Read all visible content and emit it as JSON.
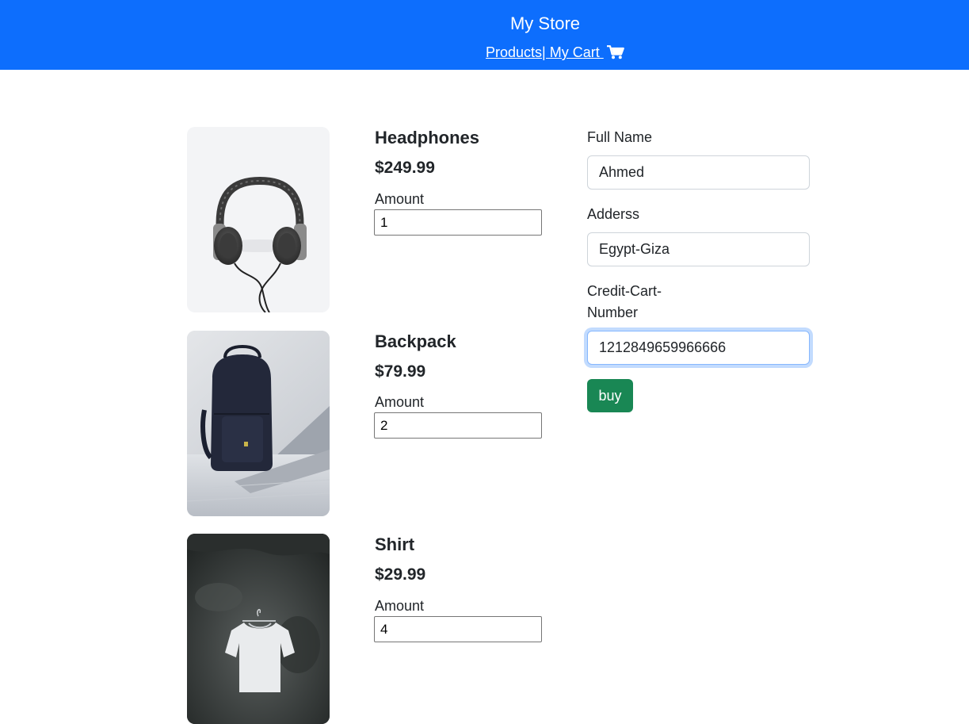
{
  "header": {
    "title": "My Store",
    "nav_products": "Products",
    "nav_cart": "| My Cart "
  },
  "products": [
    {
      "name": "Headphones",
      "price": "$249.99",
      "amount_label": "Amount",
      "amount": "1"
    },
    {
      "name": "Backpack",
      "price": "$79.99",
      "amount_label": "Amount",
      "amount": "2"
    },
    {
      "name": "Shirt",
      "price": "$29.99",
      "amount_label": "Amount",
      "amount": "4"
    }
  ],
  "form": {
    "full_name_label": "Full Name",
    "full_name_value": "Ahmed",
    "address_label": "Adderss",
    "address_value": "Egypt-Giza",
    "card_label_line1": "Credit-Cart-",
    "card_label_line2": "Number",
    "card_value": "1212849659966666",
    "buy_label": "buy"
  },
  "colors": {
    "header_bg": "#0d6efd",
    "buy_button": "#198754"
  }
}
